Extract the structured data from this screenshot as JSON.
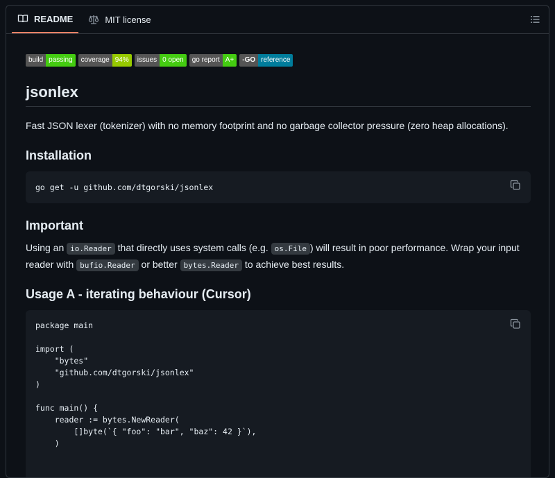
{
  "tabs": [
    {
      "label": "README",
      "icon": "book-icon",
      "active": true
    },
    {
      "label": "MIT license",
      "icon": "law-icon",
      "active": false
    }
  ],
  "badges": [
    {
      "left": "build",
      "right": "passing",
      "color": "#4c1"
    },
    {
      "left": "coverage",
      "right": "94%",
      "color": "#97ca00"
    },
    {
      "left": "issues",
      "right": "0 open",
      "color": "#4c1"
    },
    {
      "left": "go report",
      "right": "A+",
      "color": "#4c1"
    },
    {
      "left": "-GO",
      "right": "reference",
      "color": "#007d9c"
    }
  ],
  "title": "jsonlex",
  "description": "Fast JSON lexer (tokenizer) with no memory footprint and no garbage collector pressure (zero heap allocations).",
  "installation": {
    "heading": "Installation",
    "command": "go get -u github.com/dtgorski/jsonlex"
  },
  "important": {
    "heading": "Important",
    "p1": "Using an ",
    "c1": "io.Reader",
    "p2": " that directly uses system calls (e.g. ",
    "c2": "os.File",
    "p3": ") will result in poor performance. Wrap your input reader with ",
    "c3": "bufio.Reader",
    "p4": " or better ",
    "c4": "bytes.Reader",
    "p5": " to achieve best results."
  },
  "usage_a": {
    "heading": "Usage A - iterating behaviour (Cursor)",
    "code": "package main\n\nimport (\n    \"bytes\"\n    \"github.com/dtgorski/jsonlex\"\n)\n\nfunc main() {\n    reader := bytes.NewReader(\n        []byte(`{ \"foo\": \"bar\", \"baz\": 42 }`),\n    )"
  }
}
